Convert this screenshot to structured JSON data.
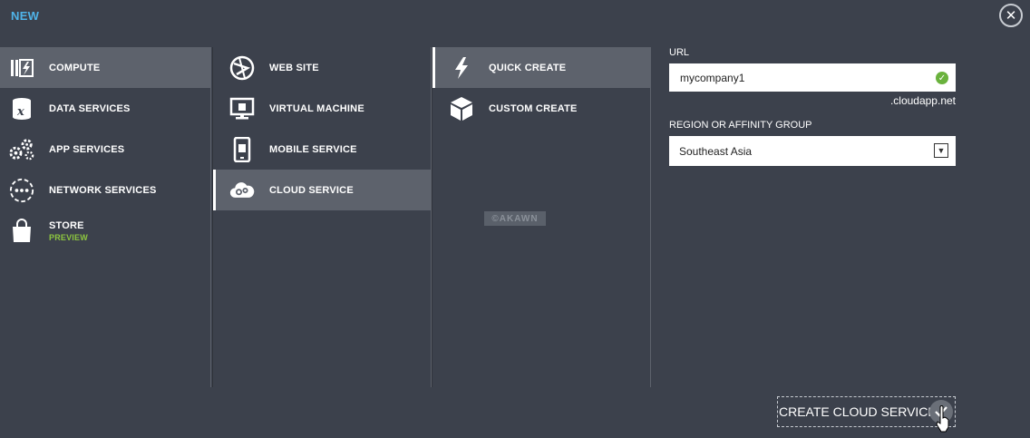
{
  "header": {
    "title": "NEW"
  },
  "categories": [
    {
      "label": "COMPUTE",
      "icon": "compute-icon",
      "selected": true
    },
    {
      "label": "DATA SERVICES",
      "icon": "data-services-icon"
    },
    {
      "label": "APP SERVICES",
      "icon": "app-services-icon"
    },
    {
      "label": "NETWORK SERVICES",
      "icon": "network-services-icon"
    },
    {
      "label": "STORE",
      "sublabel": "PREVIEW",
      "icon": "store-icon"
    }
  ],
  "services": [
    {
      "label": "WEB SITE",
      "icon": "web-site-icon"
    },
    {
      "label": "VIRTUAL MACHINE",
      "icon": "virtual-machine-icon"
    },
    {
      "label": "MOBILE SERVICE",
      "icon": "mobile-service-icon"
    },
    {
      "label": "CLOUD SERVICE",
      "icon": "cloud-service-icon",
      "selected": true
    }
  ],
  "methods": [
    {
      "label": "QUICK CREATE",
      "icon": "lightning-icon",
      "selected": true
    },
    {
      "label": "CUSTOM CREATE",
      "icon": "box-icon"
    }
  ],
  "watermark": "©AKAWN",
  "form": {
    "url_label": "URL",
    "url_value": "mycompany1",
    "url_suffix": ".cloudapp.net",
    "region_label": "REGION OR AFFINITY GROUP",
    "region_value": "Southeast Asia"
  },
  "action": {
    "create_label": "CREATE CLOUD SERVICE"
  },
  "colors": {
    "accent": "#4fb3e8",
    "preview": "#8dc63f",
    "valid": "#6ab23d",
    "background": "#3c414c",
    "selected": "#5d626c"
  }
}
